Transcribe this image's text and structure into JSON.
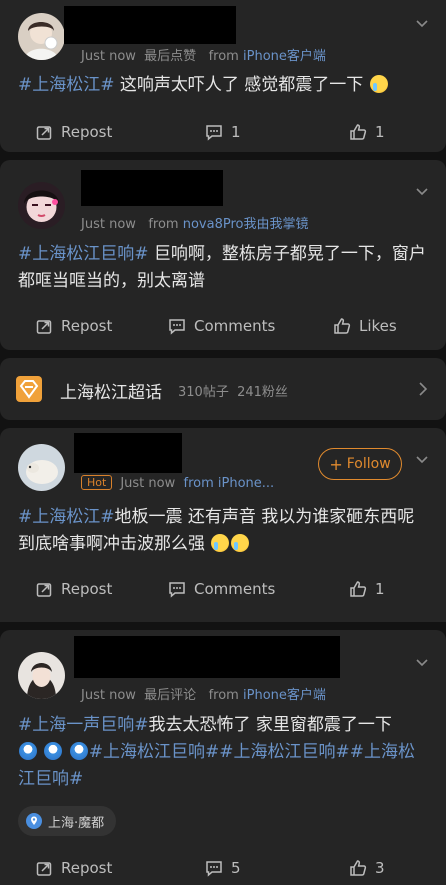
{
  "posts": [
    {
      "time": "Just now",
      "extra": "最后点赞",
      "source_prefix": "from",
      "source": "iPhone客户端",
      "text_tag": "#上海松江#",
      "text": " 这响声太吓人了 感觉都震了一下",
      "actions": {
        "repost": "Repost",
        "comments": "1",
        "likes": "1"
      }
    },
    {
      "time": "Just now",
      "source_prefix": "from",
      "source": "nova8Pro我由我掌镜",
      "text_tag": "#上海松江巨响#",
      "text": " 巨响啊，整栋房子都晃了一下，窗户都哐当哐当的，别太离谱",
      "actions": {
        "repost": "Repost",
        "comments": "Comments",
        "likes": "Likes"
      }
    }
  ],
  "topic": {
    "name": "上海松江超话",
    "posts": "310帖子",
    "fans": "241粉丝"
  },
  "post3": {
    "hot": "Hot",
    "time": "Just now",
    "source": "from iPhone...",
    "follow": "Follow",
    "text_tag": "#上海松江#",
    "text": "地板一震 还有声音 我以为谁家砸东西呢 到底啥事啊冲击波那么强",
    "actions": {
      "repost": "Repost",
      "comments": "Comments",
      "likes": "1"
    }
  },
  "post4": {
    "time": "Just now",
    "extra": "最后评论",
    "source_prefix": "from",
    "source": "iPhone客户端",
    "text_tag": "#上海一声巨响#",
    "text": "我去太恐怖了 家里窗都震了一下",
    "tags_line": "#上海松江巨响##上海松江巨响##上海松江巨响#",
    "location": "上海·魔都",
    "actions": {
      "repost": "Repost",
      "comments": "5",
      "likes": "3"
    }
  },
  "colors": {
    "background": "#121212",
    "card": "#252525",
    "link": "#6a93c9",
    "accent_orange": "#e08a2e",
    "muted": "#8d8d8d"
  }
}
